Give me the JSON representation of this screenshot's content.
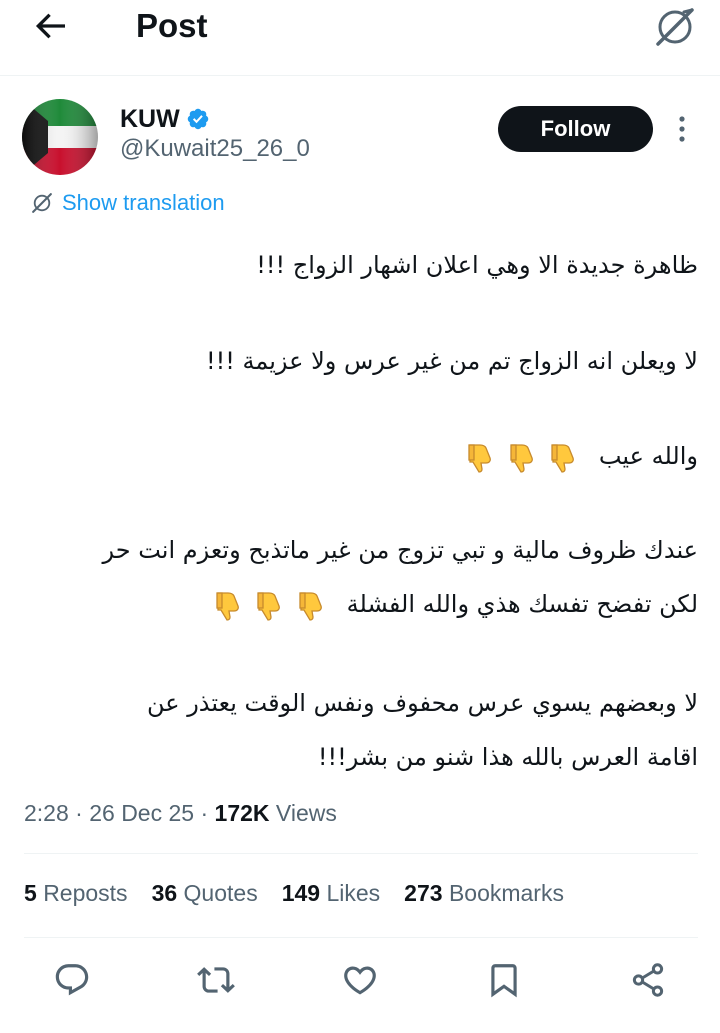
{
  "header": {
    "title": "Post",
    "back_icon": "arrow-left-icon",
    "grok_icon": "grok-icon"
  },
  "author": {
    "display_name": "KUW",
    "handle": "@Kuwait25_26_0",
    "verified": true,
    "avatar": "kuwait-flag",
    "follow_label": "Follow"
  },
  "translation_label": "Show translation",
  "tweet": {
    "lines": [
      {
        "text": "ظاهرة جديدة الا وهي اعلان اشهار الزواج !!!",
        "thumbs": 0
      },
      {
        "text": "لا ويعلن انه الزواج تم من غير عرس ولا عزيمة  !!!",
        "thumbs": 0
      },
      {
        "text": "والله عيب",
        "thumbs": 3
      },
      {
        "text": "عندك ظروف مالية و تبي تزوج من غير ماتذبح وتعزم انت حر",
        "thumbs": 0
      },
      {
        "text": "لكن تفضح تفسك هذي والله الفشلة",
        "thumbs": 3
      },
      {
        "text": "لا وبعضهم يسوي عرس محفوف ونفس الوقت يعتذر عن",
        "thumbs": 0
      },
      {
        "text": "اقامة العرس بالله هذا شنو من بشر!!!",
        "thumbs": 0
      }
    ]
  },
  "meta": {
    "time": "2:28",
    "date": "26 Dec 25",
    "views_count": "172K",
    "views_label": "Views"
  },
  "stats": [
    {
      "num": "5",
      "label": "Reposts"
    },
    {
      "num": "36",
      "label": "Quotes"
    },
    {
      "num": "149",
      "label": "Likes"
    },
    {
      "num": "273",
      "label": "Bookmarks"
    }
  ],
  "actions": [
    "reply-icon",
    "repost-icon",
    "like-icon",
    "bookmark-icon",
    "share-icon"
  ],
  "colors": {
    "link": "#1d9bf0",
    "secondary": "#536471",
    "primary": "#0f1419",
    "verified": "#1d9bf0"
  }
}
